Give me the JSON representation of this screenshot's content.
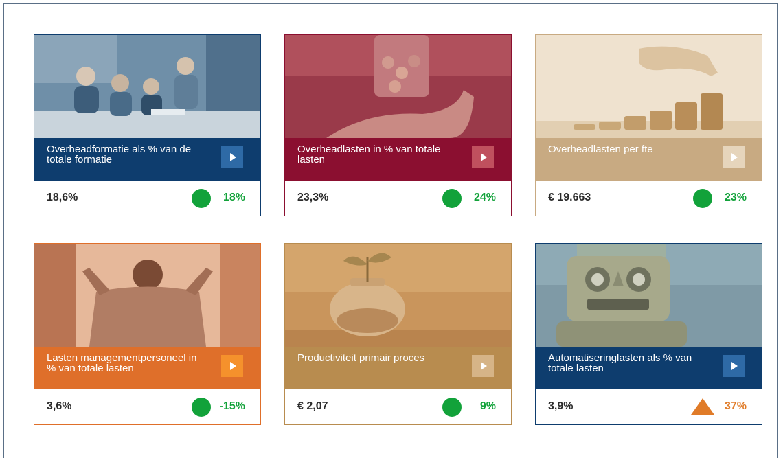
{
  "colors": {
    "navy": "#0e3d6e",
    "burgundy": "#8b0f30",
    "sand": "#c8aa82",
    "orange": "#df6f2a",
    "gold": "#b88c4f",
    "good": "#12a23a",
    "warn": "#e07b28"
  },
  "cards": [
    {
      "title": "Overheadformatie als % van de totale formatie",
      "value": "18,6%",
      "change": "18%",
      "status": "good",
      "image": "people-meeting-photo"
    },
    {
      "title": "Overheadlasten in % van totale lasten",
      "value": "23,3%",
      "change": "24%",
      "status": "good",
      "image": "coins-in-hand-photo"
    },
    {
      "title": "Overheadlasten per fte",
      "value": "€ 19.663",
      "change": "23%",
      "status": "good",
      "image": "coin-stacks-photo"
    },
    {
      "title": "Lasten managementpersoneel in % van totale lasten",
      "value": "3,6%",
      "change": "-15%",
      "status": "good",
      "image": "man-at-window-photo"
    },
    {
      "title": "Productiviteit primair proces",
      "value": "€ 2,07",
      "change": "9%",
      "status": "good",
      "image": "plant-in-coin-jar-photo"
    },
    {
      "title": "Automatiseringlasten als % van totale lasten",
      "value": "3,9%",
      "change": "37%",
      "status": "warn",
      "image": "toy-robot-photo"
    }
  ]
}
